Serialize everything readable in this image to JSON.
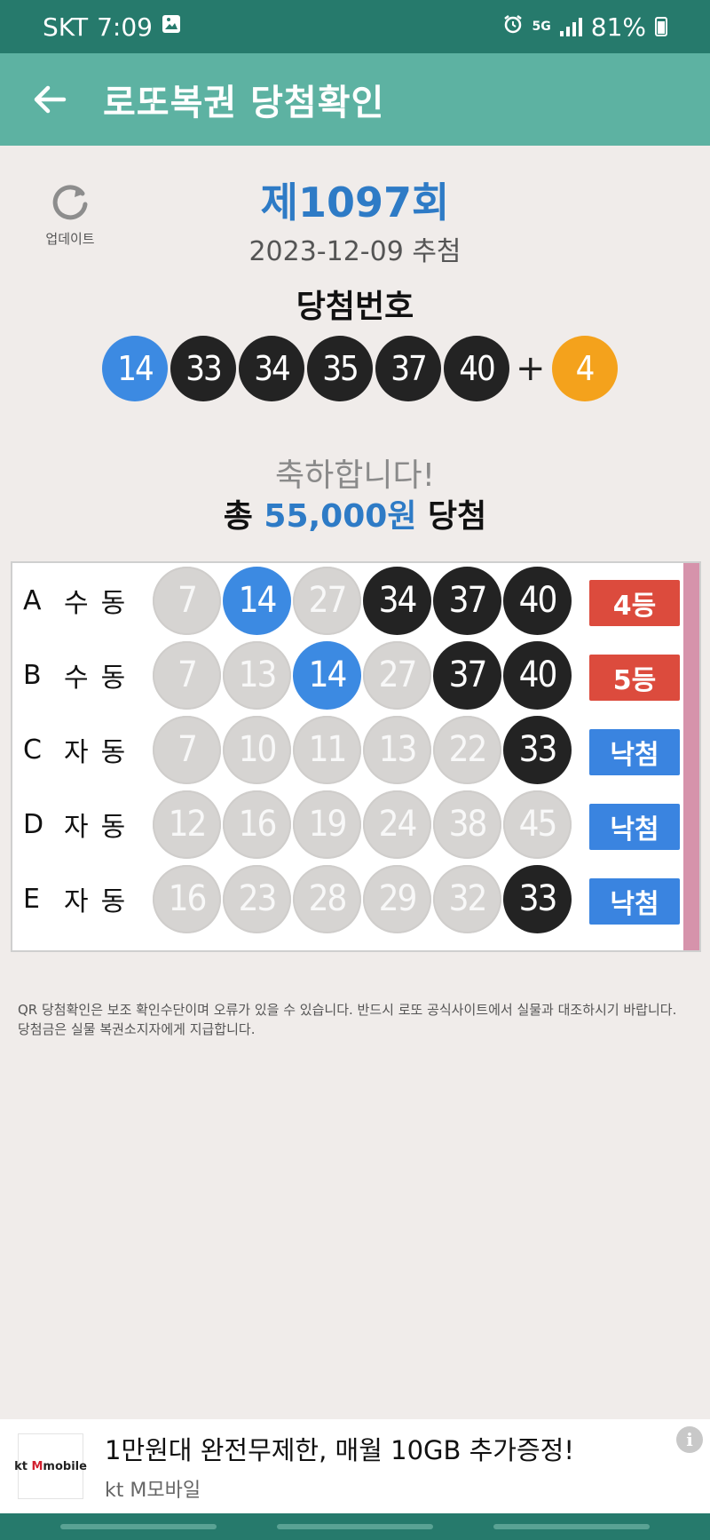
{
  "status_bar": {
    "carrier": "SKT",
    "time": "7:09",
    "network": "5G",
    "battery": "81%"
  },
  "app_bar": {
    "title": "로또복권 당첨확인"
  },
  "header": {
    "refresh_label": "업데이트",
    "round": "제1097회",
    "date": "2023-12-09 추첨",
    "win_label": "당첨번호",
    "winning_numbers": [
      "14",
      "33",
      "34",
      "35",
      "37",
      "40"
    ],
    "plus": "+",
    "bonus": "4",
    "congrats": "축하합니다!",
    "prize_prefix": "총",
    "prize_amount": "55,000원",
    "prize_suffix": "당첨"
  },
  "tickets": [
    {
      "letter": "A",
      "mode": "수동",
      "numbers": [
        "7",
        "14",
        "27",
        "34",
        "37",
        "40"
      ],
      "colors": [
        "grey",
        "blue",
        "grey",
        "black",
        "black",
        "black"
      ],
      "result": "4등",
      "status": "win"
    },
    {
      "letter": "B",
      "mode": "수동",
      "numbers": [
        "7",
        "13",
        "14",
        "27",
        "37",
        "40"
      ],
      "colors": [
        "grey",
        "grey",
        "blue",
        "grey",
        "black",
        "black"
      ],
      "result": "5등",
      "status": "win"
    },
    {
      "letter": "C",
      "mode": "자동",
      "numbers": [
        "7",
        "10",
        "11",
        "13",
        "22",
        "33"
      ],
      "colors": [
        "grey",
        "grey",
        "grey",
        "grey",
        "grey",
        "black"
      ],
      "result": "낙첨",
      "status": "lose"
    },
    {
      "letter": "D",
      "mode": "자동",
      "numbers": [
        "12",
        "16",
        "19",
        "24",
        "38",
        "45"
      ],
      "colors": [
        "grey",
        "grey",
        "grey",
        "grey",
        "grey",
        "grey"
      ],
      "result": "낙첨",
      "status": "lose"
    },
    {
      "letter": "E",
      "mode": "자동",
      "numbers": [
        "16",
        "23",
        "28",
        "29",
        "32",
        "33"
      ],
      "colors": [
        "grey",
        "grey",
        "grey",
        "grey",
        "grey",
        "black"
      ],
      "result": "낙첨",
      "status": "lose"
    }
  ],
  "notice": "QR 당첨확인은 보조 확인수단이며 오류가 있을 수 있습니다. 반드시 로또 공식사이트에서 실물과 대조하시기 바랍니다. 당첨금은 실물 복권소지자에게 지급합니다.",
  "ad": {
    "logo_kt": "kt",
    "logo_m": "M",
    "logo_rest": "mobile",
    "title": "1만원대 완전무제한, 매월 10GB 추가증정!",
    "advertiser": "kt M모바일",
    "info": "i"
  },
  "colors": {
    "status_bar": "#267a6c",
    "app_bar": "#5db2a2",
    "accent_blue": "#2e7bc6",
    "bonus": "#f4a21c",
    "win_badge": "#dc4b3d",
    "lose_badge": "#3a84e0"
  }
}
